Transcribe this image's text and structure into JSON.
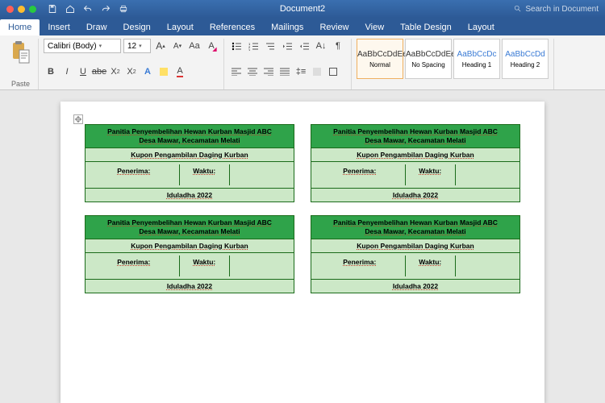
{
  "title": "Document2",
  "search_placeholder": "Search in Document",
  "tabs": [
    "Home",
    "Insert",
    "Draw",
    "Design",
    "Layout",
    "References",
    "Mailings",
    "Review",
    "View",
    "Table Design",
    "Layout"
  ],
  "active_tab": 0,
  "ribbon": {
    "paste": "Paste",
    "font_name": "Calibri (Body)",
    "font_size": "12",
    "styles": [
      {
        "sample": "AaBbCcDdEe",
        "name": "Normal"
      },
      {
        "sample": "AaBbCcDdEe",
        "name": "No Spacing"
      },
      {
        "sample": "AaBbCcDc",
        "name": "Heading 1"
      },
      {
        "sample": "AaBbCcDd",
        "name": "Heading 2"
      }
    ]
  },
  "coupon": {
    "header_l1": "Panitia Penyembelihan Hewan Kurban Masjid ABC",
    "header_l2": "Desa Mawar, Kecamatan Melati",
    "subtitle": "Kupon Pengambilan Daging Kurban",
    "field_left": "Penerima:",
    "field_right": "Waktu:",
    "footer": "Iduladha 2022"
  }
}
